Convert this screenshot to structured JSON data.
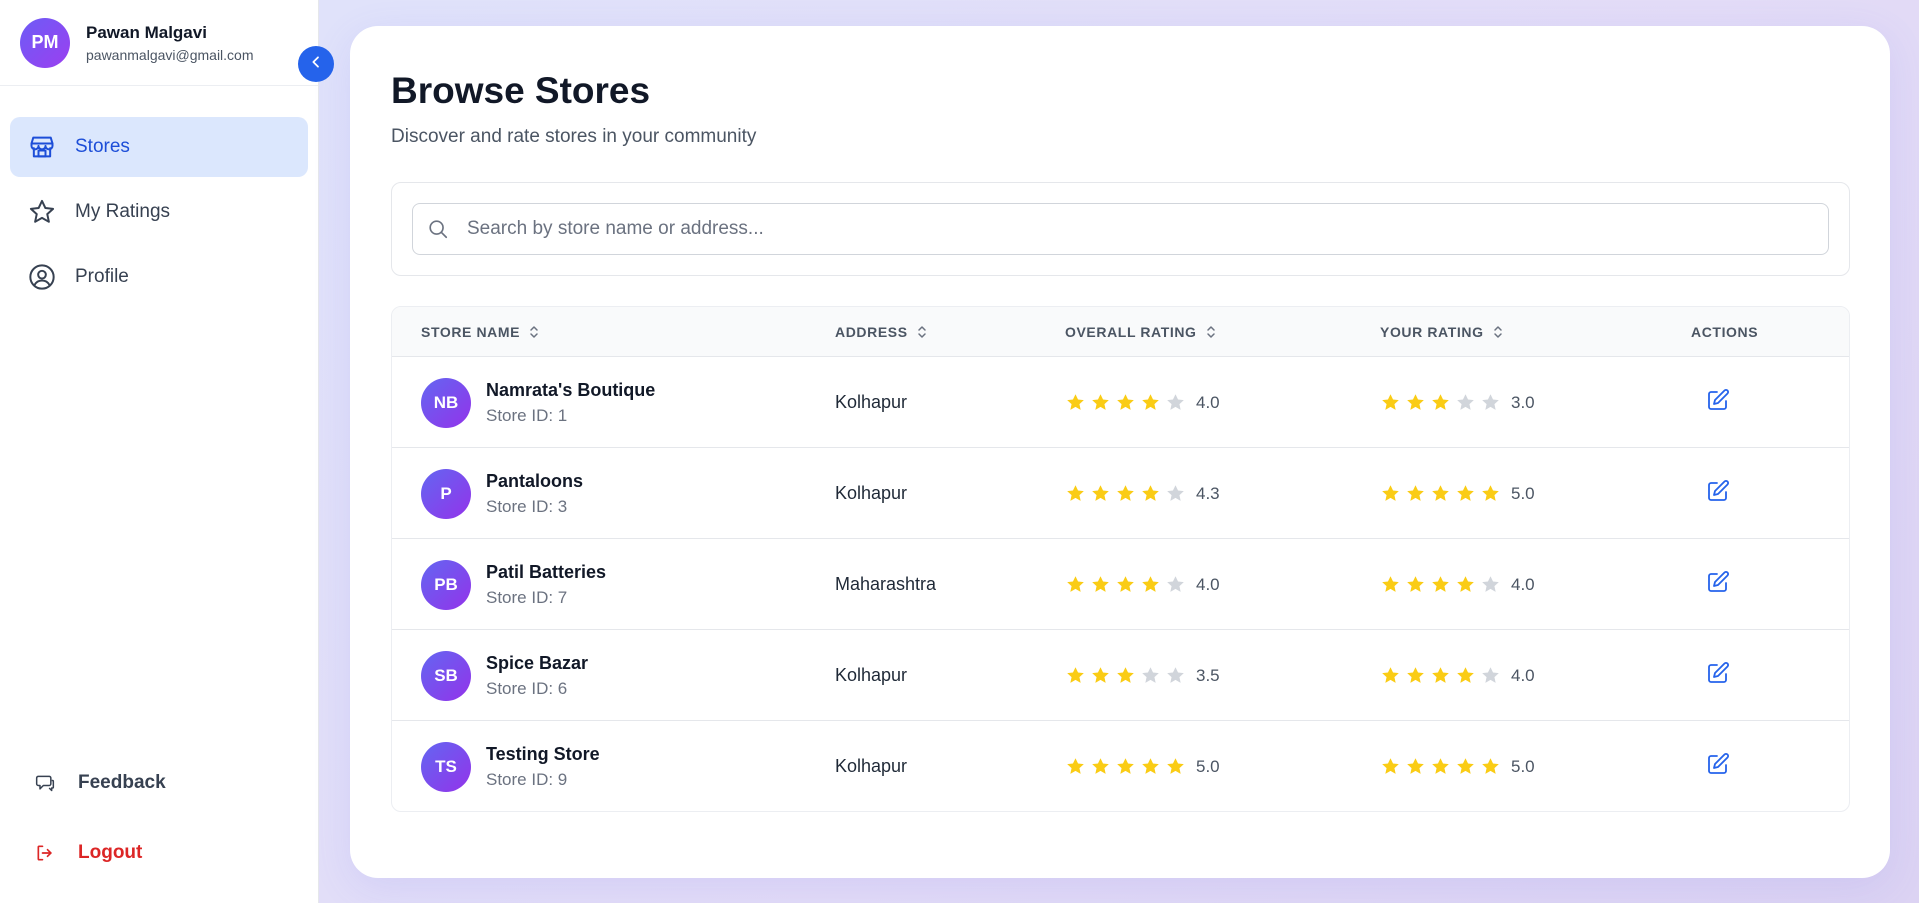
{
  "user": {
    "initials": "PM",
    "name": "Pawan Malgavi",
    "email": "pawanmalgavi@gmail.com"
  },
  "sidebar": {
    "items": [
      {
        "label": "Stores",
        "icon": "store-icon",
        "active": true
      },
      {
        "label": "My Ratings",
        "icon": "star-icon",
        "active": false
      },
      {
        "label": "Profile",
        "icon": "user-circle-icon",
        "active": false
      }
    ],
    "feedback_label": "Feedback",
    "logout_label": "Logout"
  },
  "page": {
    "title": "Browse Stores",
    "subtitle": "Discover and rate stores in your community"
  },
  "search": {
    "placeholder": "Search by store name or address...",
    "value": ""
  },
  "table": {
    "columns": [
      "STORE NAME",
      "ADDRESS",
      "OVERALL RATING",
      "YOUR RATING",
      "ACTIONS"
    ],
    "rows": [
      {
        "initials": "NB",
        "name": "Namrata's Boutique",
        "store_id": "Store ID: 1",
        "address": "Kolhapur",
        "overall_rating": "4.0",
        "overall_stars": 4,
        "your_rating": "3.0",
        "your_stars": 3
      },
      {
        "initials": "P",
        "name": "Pantaloons",
        "store_id": "Store ID: 3",
        "address": "Kolhapur",
        "overall_rating": "4.3",
        "overall_stars": 4,
        "your_rating": "5.0",
        "your_stars": 5
      },
      {
        "initials": "PB",
        "name": "Patil Batteries",
        "store_id": "Store ID: 7",
        "address": "Maharashtra",
        "overall_rating": "4.0",
        "overall_stars": 4,
        "your_rating": "4.0",
        "your_stars": 4
      },
      {
        "initials": "SB",
        "name": "Spice Bazar",
        "store_id": "Store ID: 6",
        "address": "Kolhapur",
        "overall_rating": "3.5",
        "overall_stars": 3,
        "your_rating": "4.0",
        "your_stars": 4
      },
      {
        "initials": "TS",
        "name": "Testing Store",
        "store_id": "Store ID: 9",
        "address": "Kolhapur",
        "overall_rating": "5.0",
        "overall_stars": 5,
        "your_rating": "5.0",
        "your_stars": 5
      }
    ]
  },
  "colors": {
    "accent": "#2563eb",
    "active_bg": "#dbe7fd",
    "star_filled": "#facc15",
    "star_empty": "#d1d5db",
    "logout": "#dc2626"
  }
}
